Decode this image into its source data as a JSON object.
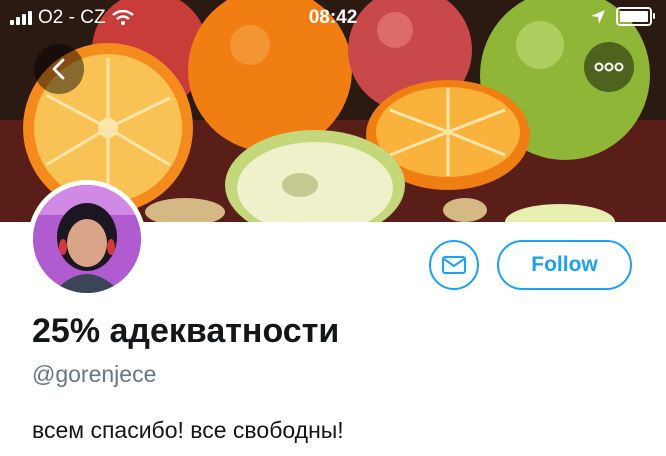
{
  "status_bar": {
    "carrier": "O2 - CZ",
    "time": "08:42"
  },
  "header": {
    "banner_description": ""
  },
  "icons": {
    "back": "chevron-left-icon",
    "more": "more-horizontal-icon",
    "message": "envelope-icon",
    "wifi": "wifi-icon",
    "location": "location-arrow-icon",
    "battery": "battery-icon",
    "signal": "signal-bars-icon"
  },
  "profile": {
    "display_name": "25% адекватности",
    "handle": "@gorenjece",
    "bio": "всем спасибо! все свободны!",
    "follow_label": "Follow"
  },
  "colors": {
    "accent": "#1da1f2",
    "text": "#14171a",
    "muted": "#657786"
  }
}
